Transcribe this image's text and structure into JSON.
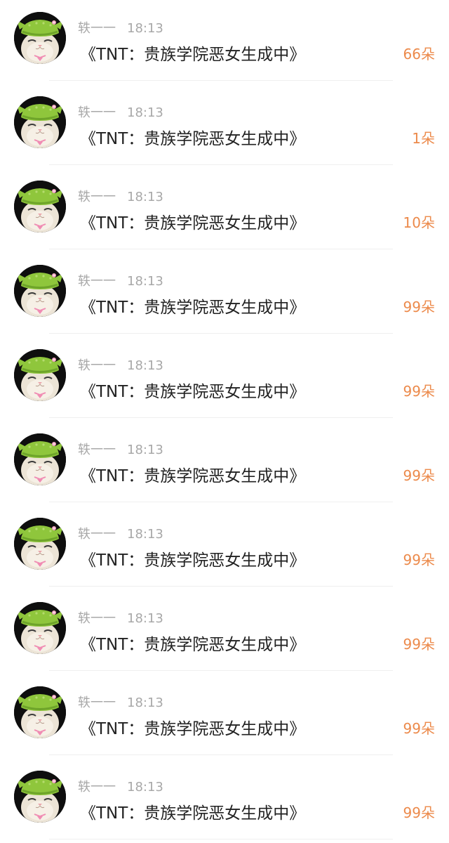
{
  "colors": {
    "name": "#a8a8a8",
    "title": "#222222",
    "count": "#ec8a4b",
    "divider": "#efefef"
  },
  "avatar_icon": "cat-with-green-knit-hat",
  "items": [
    {
      "username": "轶一一",
      "time": "18:13",
      "title": "《TNT：贵族学院恶女生成中》",
      "count": "66朵"
    },
    {
      "username": "轶一一",
      "time": "18:13",
      "title": "《TNT：贵族学院恶女生成中》",
      "count": "1朵"
    },
    {
      "username": "轶一一",
      "time": "18:13",
      "title": "《TNT：贵族学院恶女生成中》",
      "count": "10朵"
    },
    {
      "username": "轶一一",
      "time": "18:13",
      "title": "《TNT：贵族学院恶女生成中》",
      "count": "99朵"
    },
    {
      "username": "轶一一",
      "time": "18:13",
      "title": "《TNT：贵族学院恶女生成中》",
      "count": "99朵"
    },
    {
      "username": "轶一一",
      "time": "18:13",
      "title": "《TNT：贵族学院恶女生成中》",
      "count": "99朵"
    },
    {
      "username": "轶一一",
      "time": "18:13",
      "title": "《TNT：贵族学院恶女生成中》",
      "count": "99朵"
    },
    {
      "username": "轶一一",
      "time": "18:13",
      "title": "《TNT：贵族学院恶女生成中》",
      "count": "99朵"
    },
    {
      "username": "轶一一",
      "time": "18:13",
      "title": "《TNT：贵族学院恶女生成中》",
      "count": "99朵"
    },
    {
      "username": "轶一一",
      "time": "18:13",
      "title": "《TNT：贵族学院恶女生成中》",
      "count": "99朵"
    }
  ]
}
